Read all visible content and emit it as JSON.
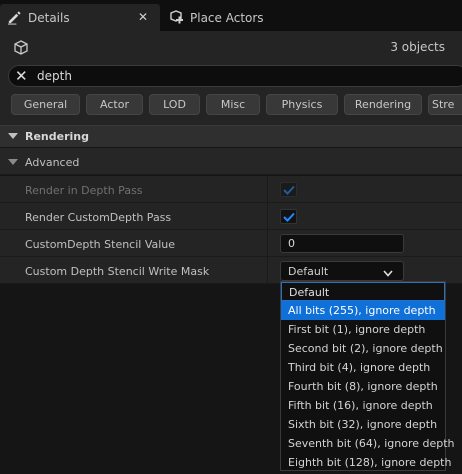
{
  "tabs": [
    {
      "label": "Details",
      "active": true,
      "icon": "pencil-icon"
    },
    {
      "label": "Place Actors",
      "active": false,
      "icon": "place-actors-icon"
    }
  ],
  "header": {
    "selection_icon": "cube-icon",
    "object_count": "3 objects"
  },
  "search": {
    "value": "depth",
    "clear_icon": "close-icon"
  },
  "categories": [
    "General",
    "Actor",
    "LOD",
    "Misc",
    "Physics",
    "Rendering",
    "Stre"
  ],
  "section": {
    "label": "Rendering"
  },
  "subsection": {
    "label": "Advanced"
  },
  "properties": [
    {
      "label": "Render in Depth Pass",
      "type": "checkbox",
      "checked": true,
      "enabled": false
    },
    {
      "label": "Render CustomDepth Pass",
      "type": "checkbox",
      "checked": true,
      "enabled": true
    },
    {
      "label": "CustomDepth Stencil Value",
      "type": "number",
      "value": "0"
    },
    {
      "label": "Custom Depth Stencil Write Mask",
      "type": "combo",
      "value": "Default"
    }
  ],
  "dropdown": {
    "options": [
      "Default",
      "All bits (255), ignore depth",
      "First bit (1), ignore depth",
      "Second bit (2), ignore depth",
      "Third bit (4), ignore depth",
      "Fourth bit (8), ignore depth",
      "Fifth bit (16), ignore depth",
      "Sixth bit (32), ignore depth",
      "Seventh bit (64), ignore depth",
      "Eighth bit (128), ignore depth"
    ],
    "current_index": 0,
    "highlighted_index": 1
  },
  "colors": {
    "accent": "#0e70d8",
    "background": "#242424",
    "check": "#1e8bff"
  }
}
